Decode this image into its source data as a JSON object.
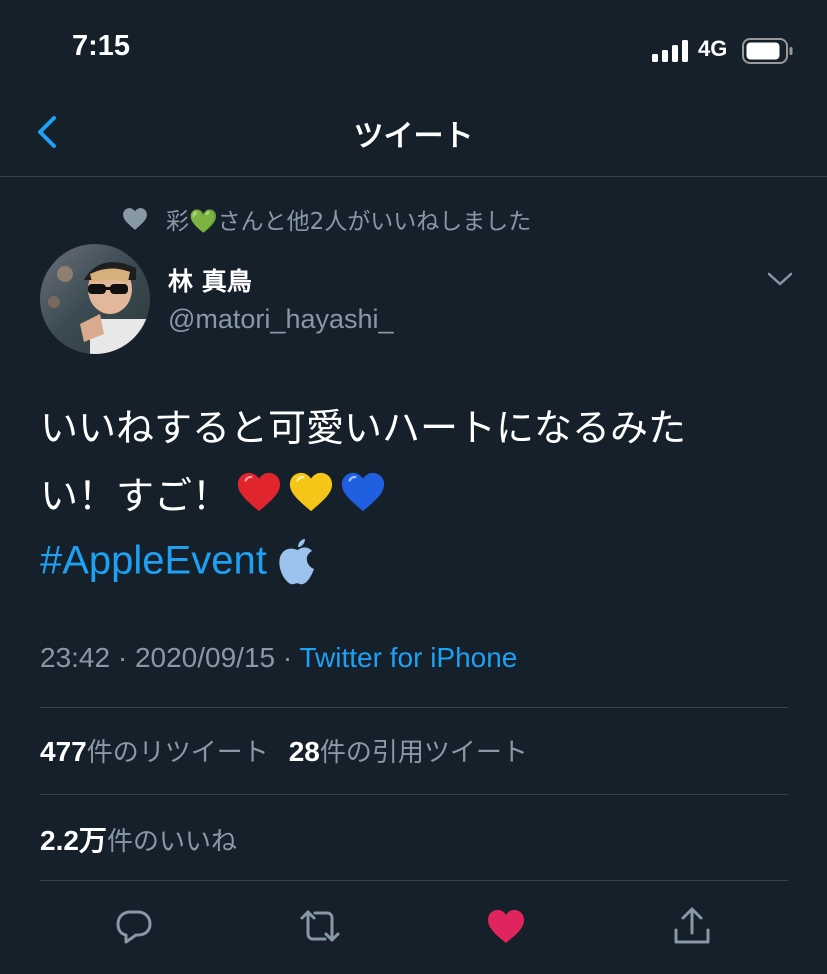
{
  "status_bar": {
    "time": "7:15",
    "network": "4G"
  },
  "nav": {
    "title": "ツイート"
  },
  "social_context": {
    "text": "彩💚さんと他2人がいいねしました"
  },
  "author": {
    "display_name": "林 真鳥",
    "handle": "@matori_hayashi_"
  },
  "tweet": {
    "text_line1": "いいねすると可愛いハートになるみた",
    "text_line2": "い！すご！",
    "emojis": [
      "red-heart",
      "yellow-heart",
      "blue-heart"
    ],
    "hashtag": "#AppleEvent",
    "time": "23:42",
    "date": "2020/09/15",
    "separator": " · ",
    "source": "Twitter for iPhone"
  },
  "stats": {
    "retweets_count": "477",
    "retweets_label": "件のリツイート",
    "quotes_count": "28",
    "quotes_label": "件の引用ツイート",
    "likes_count": "2.2万",
    "likes_label": "件のいいね"
  },
  "actions": [
    "reply-icon",
    "retweet-icon",
    "like-icon",
    "share-icon"
  ],
  "colors": {
    "background": "#15202b",
    "accent": "#1da1f2",
    "secondary_text": "#8899a6",
    "divider": "#38444d",
    "like": "#e0245e"
  }
}
